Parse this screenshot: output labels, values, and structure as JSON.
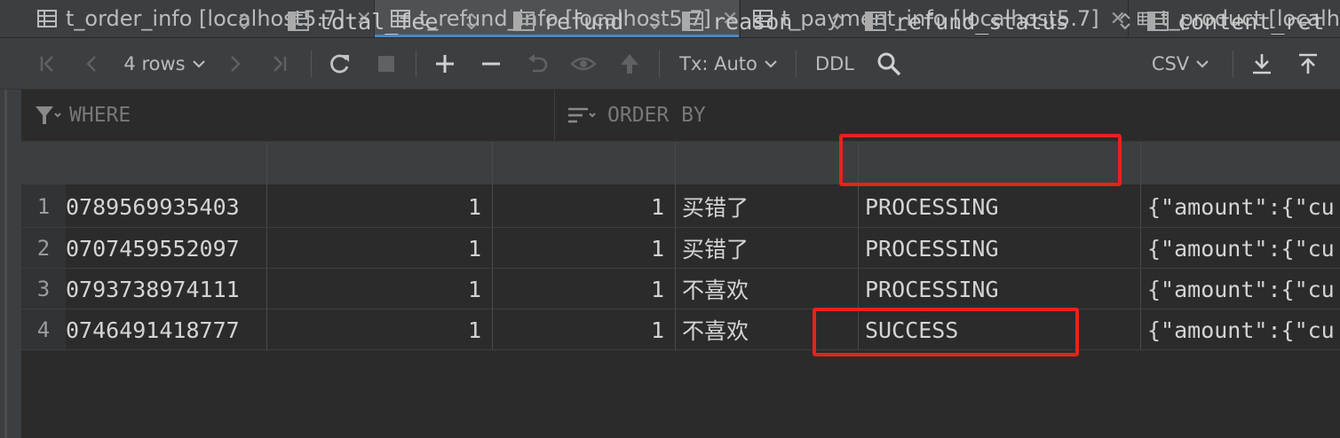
{
  "tabs": [
    {
      "label": "t_order_info [localhost5.7]"
    },
    {
      "label": "t_refund_info [localhost5.7]"
    },
    {
      "label": "t_payment_info [localhost5.7]"
    },
    {
      "label": "t_product [localh"
    }
  ],
  "toolbar": {
    "rows_label": "4 rows",
    "tx_label": "Tx: Auto",
    "ddl_label": "DDL",
    "export_format": "CSV"
  },
  "filter": {
    "where_label": "WHERE",
    "order_label": "ORDER BY"
  },
  "table": {
    "columns": [
      "total_fee",
      "refund",
      "reason",
      "refund_status",
      "content_ret"
    ],
    "rows": [
      {
        "num": "1",
        "id": "0789569935403",
        "total_fee": "1",
        "refund": "1",
        "reason": "买错了",
        "refund_status": "PROCESSING",
        "content": "{\"amount\":{\"cu"
      },
      {
        "num": "2",
        "id": "0707459552097",
        "total_fee": "1",
        "refund": "1",
        "reason": "买错了",
        "refund_status": "PROCESSING",
        "content": "{\"amount\":{\"cu"
      },
      {
        "num": "3",
        "id": "0793738974111",
        "total_fee": "1",
        "refund": "1",
        "reason": "不喜欢",
        "refund_status": "PROCESSING",
        "content": "{\"amount\":{\"cu"
      },
      {
        "num": "4",
        "id": "0746491418777",
        "total_fee": "1",
        "refund": "1",
        "reason": "不喜欢",
        "refund_status": "SUCCESS",
        "content": "{\"amount\":{\"cu"
      }
    ]
  },
  "colors": {
    "accent": "#4a88c7",
    "highlight_box": "#e8221b"
  }
}
